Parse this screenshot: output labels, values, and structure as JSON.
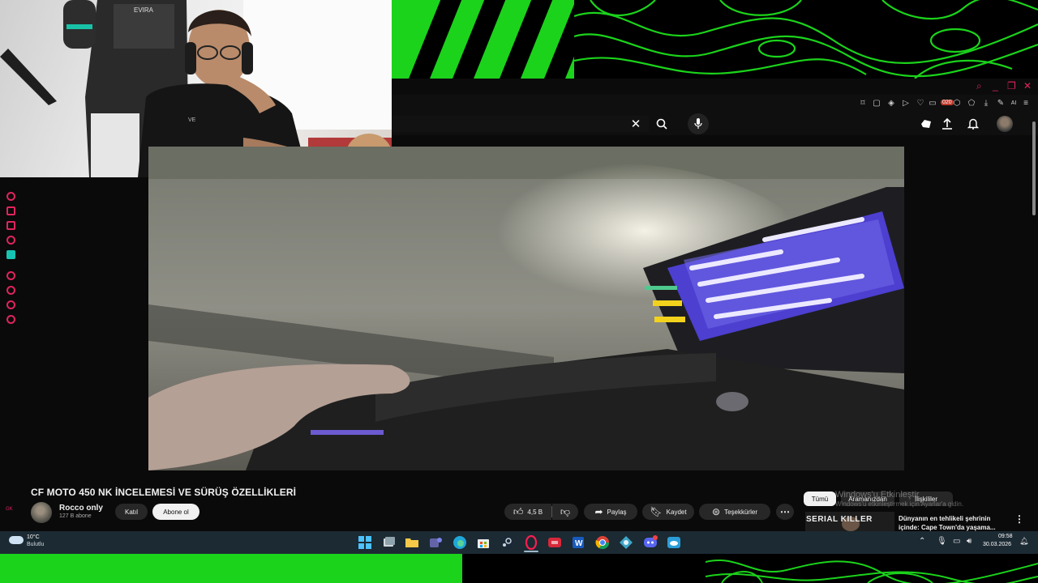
{
  "browser": {
    "window_controls": [
      "search",
      "minimize",
      "maximize",
      "close"
    ],
    "extension_badge": "020"
  },
  "youtube_header": {
    "icons": [
      "clear-icon",
      "search-icon",
      "mic-icon",
      "create-icon",
      "upload-icon",
      "notifications-icon"
    ]
  },
  "video": {
    "title": "CF MOTO 450 NK İNCELEMESİ VE SÜRÜŞ ÖZELLİKLERİ",
    "channel_name": "Rocco only",
    "subscribers": "127 B abone",
    "join_label": "Katıl",
    "subscribe_label": "Abone ol",
    "likes": "4,5 B",
    "share_label": "Paylaş",
    "save_label": "Kaydet",
    "thanks_label": "Teşekkürler"
  },
  "sidebar": {
    "chips": [
      "Tümü",
      "Aramanızdan",
      "İlişkililer"
    ],
    "activation_title": "Windows'u Etkinleştir",
    "activation_subtitle": "Windows'u etkinleştirmek için Ayarlar'a gidin.",
    "recommendation": {
      "thumb_text": "SERIAL KILLER",
      "title": "Dünyanın en tehlikeli şehrinin içinde: Cape Town'da yaşama..."
    }
  },
  "rail": {
    "bottom_text": "GK"
  },
  "taskbar": {
    "weather_temp": "10°C",
    "weather_desc": "Bulutlu",
    "time": "09:58",
    "date": "30.03.2026",
    "apps": [
      "windows-start",
      "file-manager",
      "file-explorer",
      "teams",
      "edge",
      "store",
      "steam",
      "opera-gx",
      "app-red",
      "word",
      "chrome",
      "app-bot",
      "discord",
      "app-cloud"
    ]
  },
  "colors": {
    "overlay_green": "#1bd31b",
    "accent_pink": "#e0245e",
    "taskbar": "#1c2a33"
  }
}
